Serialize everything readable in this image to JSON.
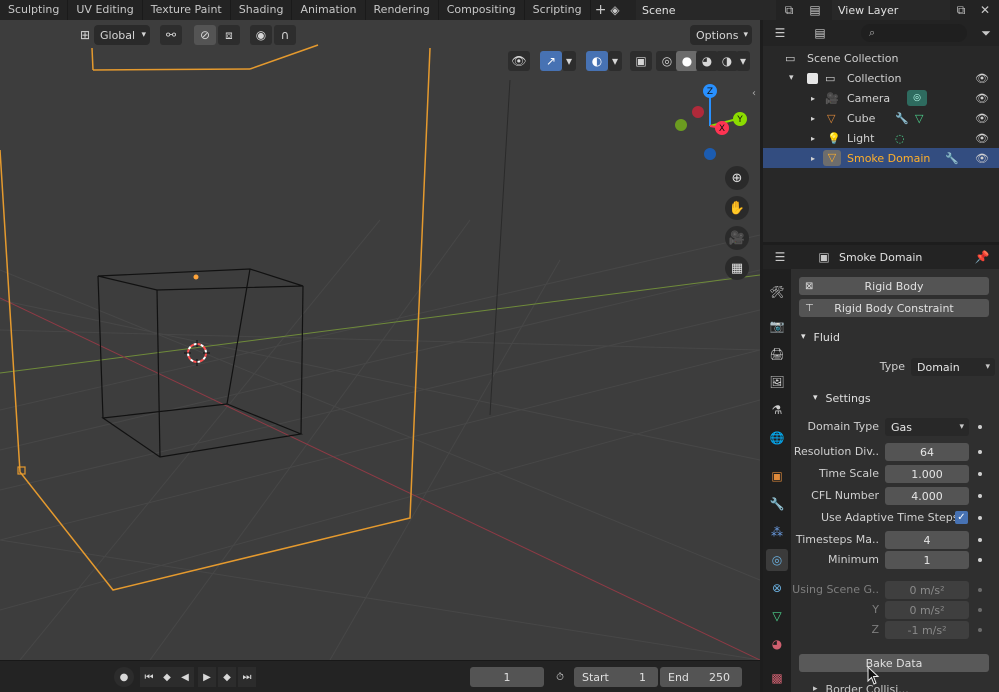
{
  "colors": {
    "accent": "#4772b3",
    "selection": "#334d80",
    "orange": "#ffaf29",
    "axis_x": "#ff3352",
    "axis_y": "#8bdc00",
    "axis_z": "#2890ff",
    "viewport_bg": "#3d3d3d"
  },
  "topbar": {
    "tabs": [
      "Sculpting",
      "UV Editing",
      "Texture Paint",
      "Shading",
      "Animation",
      "Rendering",
      "Compositing",
      "Scripting"
    ],
    "add_icon": "plus-icon",
    "scene_name": "Scene",
    "view_layer_name": "View Layer"
  },
  "viewport": {
    "orientation_label": "Global",
    "options_label": "Options",
    "gizmo": {
      "x": "X",
      "y": "Y",
      "z": "Z"
    },
    "nav_icons": [
      "zoom-icon",
      "hand-icon",
      "camera-view-icon",
      "grid-icon"
    ]
  },
  "timeline": {
    "current_frame": "1",
    "start_label": "Start",
    "start_value": "1",
    "end_label": "End",
    "end_value": "250"
  },
  "outliner": {
    "scene_collection": "Scene Collection",
    "collection": "Collection",
    "items": [
      {
        "name": "Camera",
        "icon": "camera-icon",
        "selected": false
      },
      {
        "name": "Cube",
        "icon": "mesh-icon",
        "selected": false
      },
      {
        "name": "Light",
        "icon": "light-icon",
        "selected": false
      },
      {
        "name": "Smoke Domain",
        "icon": "mesh-icon",
        "selected": true
      }
    ]
  },
  "properties": {
    "object_name": "Smoke Domain",
    "rigid_body_label": "Rigid Body",
    "rigid_body_constraint_label": "Rigid Body Constraint",
    "fluid_section": "Fluid",
    "type_label": "Type",
    "type_value": "Domain",
    "settings_section": "Settings",
    "domain_type_label": "Domain Type",
    "domain_type_value": "Gas",
    "resolution_label": "Resolution Div..",
    "resolution_value": "64",
    "time_scale_label": "Time Scale",
    "time_scale_value": "1.000",
    "cfl_label": "CFL Number",
    "cfl_value": "4.000",
    "adaptive_label": "Use Adaptive Time Steps",
    "adaptive_checked": true,
    "timesteps_max_label": "Timesteps Ma..",
    "timesteps_max_value": "4",
    "minimum_label": "Minimum",
    "minimum_value": "1",
    "gravity_label": "Using Scene G..",
    "gravity_x": "0 m/s²",
    "gravity_y_label": "Y",
    "gravity_y": "0 m/s²",
    "gravity_z_label": "Z",
    "gravity_z": "-1 m/s²",
    "bake_data_label": "Bake Data",
    "next_section": "Border Collisi..."
  }
}
